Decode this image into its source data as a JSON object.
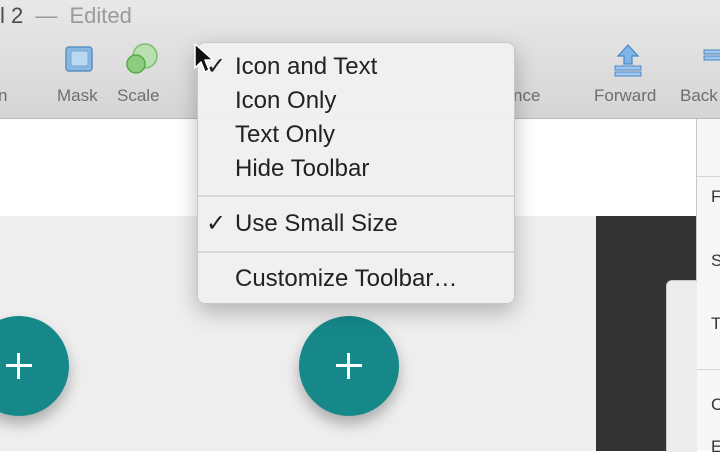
{
  "window": {
    "title_partial": "l 2",
    "title_dash": "—",
    "edited_label": "Edited"
  },
  "toolbar": {
    "items": [
      {
        "label": "n",
        "icon": "partial-icon"
      },
      {
        "label": "Mask",
        "icon": "mask-icon"
      },
      {
        "label": "Scale",
        "icon": "scale-icon"
      },
      {
        "label": "nce",
        "icon": "difference-icon"
      },
      {
        "label": "Forward",
        "icon": "forward-icon"
      },
      {
        "label": "Back",
        "icon": "backward-icon"
      }
    ]
  },
  "context_menu": {
    "items": [
      {
        "label": "Icon and Text",
        "checked": true
      },
      {
        "label": "Icon Only",
        "checked": false
      },
      {
        "label": "Text Only",
        "checked": false
      },
      {
        "label": "Hide Toolbar",
        "checked": false
      },
      {
        "label": "Use Small Size",
        "checked": true
      },
      {
        "label": "Customize Toolbar…",
        "checked": false
      }
    ],
    "check_mark": "✓"
  },
  "inspector": {
    "letters": [
      "F",
      "S",
      "T",
      "C",
      "E"
    ]
  },
  "canvas": {
    "fab_symbol": "+",
    "fab_color": "#16888a"
  }
}
